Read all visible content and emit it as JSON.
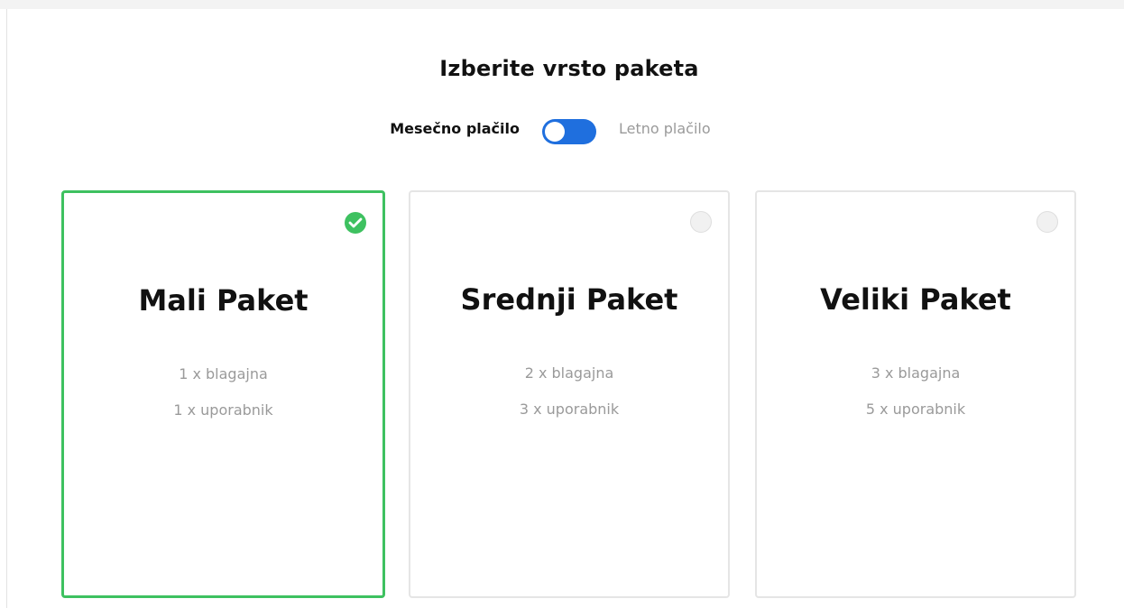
{
  "header": {
    "title": "Izberite vrsto paketa"
  },
  "billing": {
    "monthly_label": "Mesečno plačilo",
    "yearly_label": "Letno plačilo",
    "selected": "Mesečno plačilo"
  },
  "plans": [
    {
      "name": "Mali Paket",
      "features": [
        "1 x blagajna",
        "1 x uporabnik"
      ],
      "selected": true
    },
    {
      "name": "Srednji Paket",
      "features": [
        "2 x blagajna",
        "3 x uporabnik"
      ],
      "selected": false
    },
    {
      "name": "Veliki Paket",
      "features": [
        "3 x blagajna",
        "5 x uporabnik"
      ],
      "selected": false
    }
  ],
  "icons": {
    "selected_check": "check-circle-icon",
    "unselected_check": "empty-circle-icon"
  },
  "colors": {
    "accent_green": "#3ec160",
    "toggle_blue": "#1f6fde",
    "muted_text": "#9a9a9a",
    "card_border": "#e5e5e5"
  }
}
